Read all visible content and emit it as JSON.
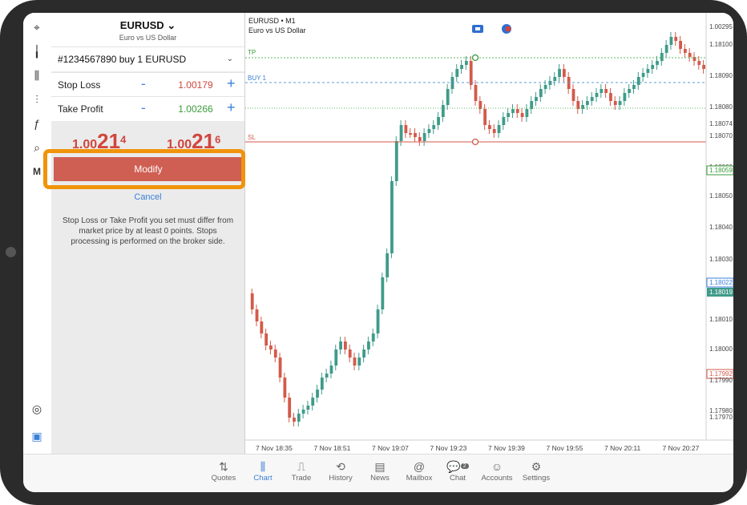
{
  "symbol": {
    "name": "EURUSD",
    "chevron": "⌄",
    "description": "Euro vs US Dollar"
  },
  "order": {
    "line": "#1234567890   buy 1 EURUSD"
  },
  "stop_loss": {
    "label": "Stop Loss",
    "minus": "-",
    "value": "1.00179",
    "plus": "+",
    "color": "#d0463d"
  },
  "take_profit": {
    "label": "Take Profit",
    "minus": "-",
    "value": "1.00266",
    "plus": "+",
    "color": "#3a9a3a"
  },
  "quotes": {
    "bid_small": "1.00",
    "bid_big": "21",
    "bid_sup": "4",
    "ask_small": "1.00",
    "ask_big": "21",
    "ask_sup": "6"
  },
  "actions": {
    "modify": "Modify",
    "cancel": "Cancel"
  },
  "note": "Stop Loss or Take Profit you set must differ from market price by at least 0 points. Stops processing is performed on the broker side.",
  "chart": {
    "symbol": "EURUSD",
    "period": "• M1",
    "description": "Euro vs US Dollar",
    "lines": {
      "tp": "TP",
      "buy": "BUY 1",
      "sl": "SL"
    },
    "price_labels": [
      "1.00295",
      "1.18100",
      "1.18090",
      "1.18080",
      "1.18074",
      "1.18070",
      "1.18060",
      "1.18059",
      "1.18050",
      "1.18040",
      "1.18030",
      "1.18022",
      "1.18019",
      "1.18010",
      "1.18000",
      "1.17992",
      "1.17990",
      "1.17980",
      "1.17970"
    ],
    "time_labels": [
      "7 Nov 18:35",
      "7 Nov 18:51",
      "7 Nov 19:07",
      "7 Nov 19:23",
      "7 Nov 19:39",
      "7 Nov 19:55",
      "7 Nov 20:11",
      "7 Nov 20:27"
    ],
    "colors": {
      "bull": "#3f9b8a",
      "bear": "#d35a4a",
      "tp": "#5cb85c",
      "sl": "#d35a4a",
      "buy": "#5b9bd5"
    }
  },
  "left_toolbar": [
    "crosshair-icon",
    "candles-icon",
    "bars-icon",
    "indicators-icon",
    "function-icon",
    "objects-icon",
    "metaquotes-icon",
    "signal-icon",
    "trading-icon"
  ],
  "left_toolbar_glyphs": [
    "⌖",
    "╽",
    "⫼",
    "⫶",
    "ƒ",
    "⌕",
    "M",
    "◎",
    "▣"
  ],
  "tabs": [
    {
      "label": "Quotes",
      "icon": "⇅",
      "active": false
    },
    {
      "label": "Chart",
      "icon": "⫼",
      "active": true
    },
    {
      "label": "Trade",
      "icon": "⎍",
      "active": false
    },
    {
      "label": "History",
      "icon": "⟲",
      "active": false
    },
    {
      "label": "News",
      "icon": "▤",
      "active": false
    },
    {
      "label": "Mailbox",
      "icon": "@",
      "active": false
    },
    {
      "label": "Chat",
      "icon": "💬",
      "badge": "2",
      "active": false
    },
    {
      "label": "Accounts",
      "icon": "☺",
      "active": false
    },
    {
      "label": "Settings",
      "icon": "⚙",
      "active": false
    }
  ]
}
